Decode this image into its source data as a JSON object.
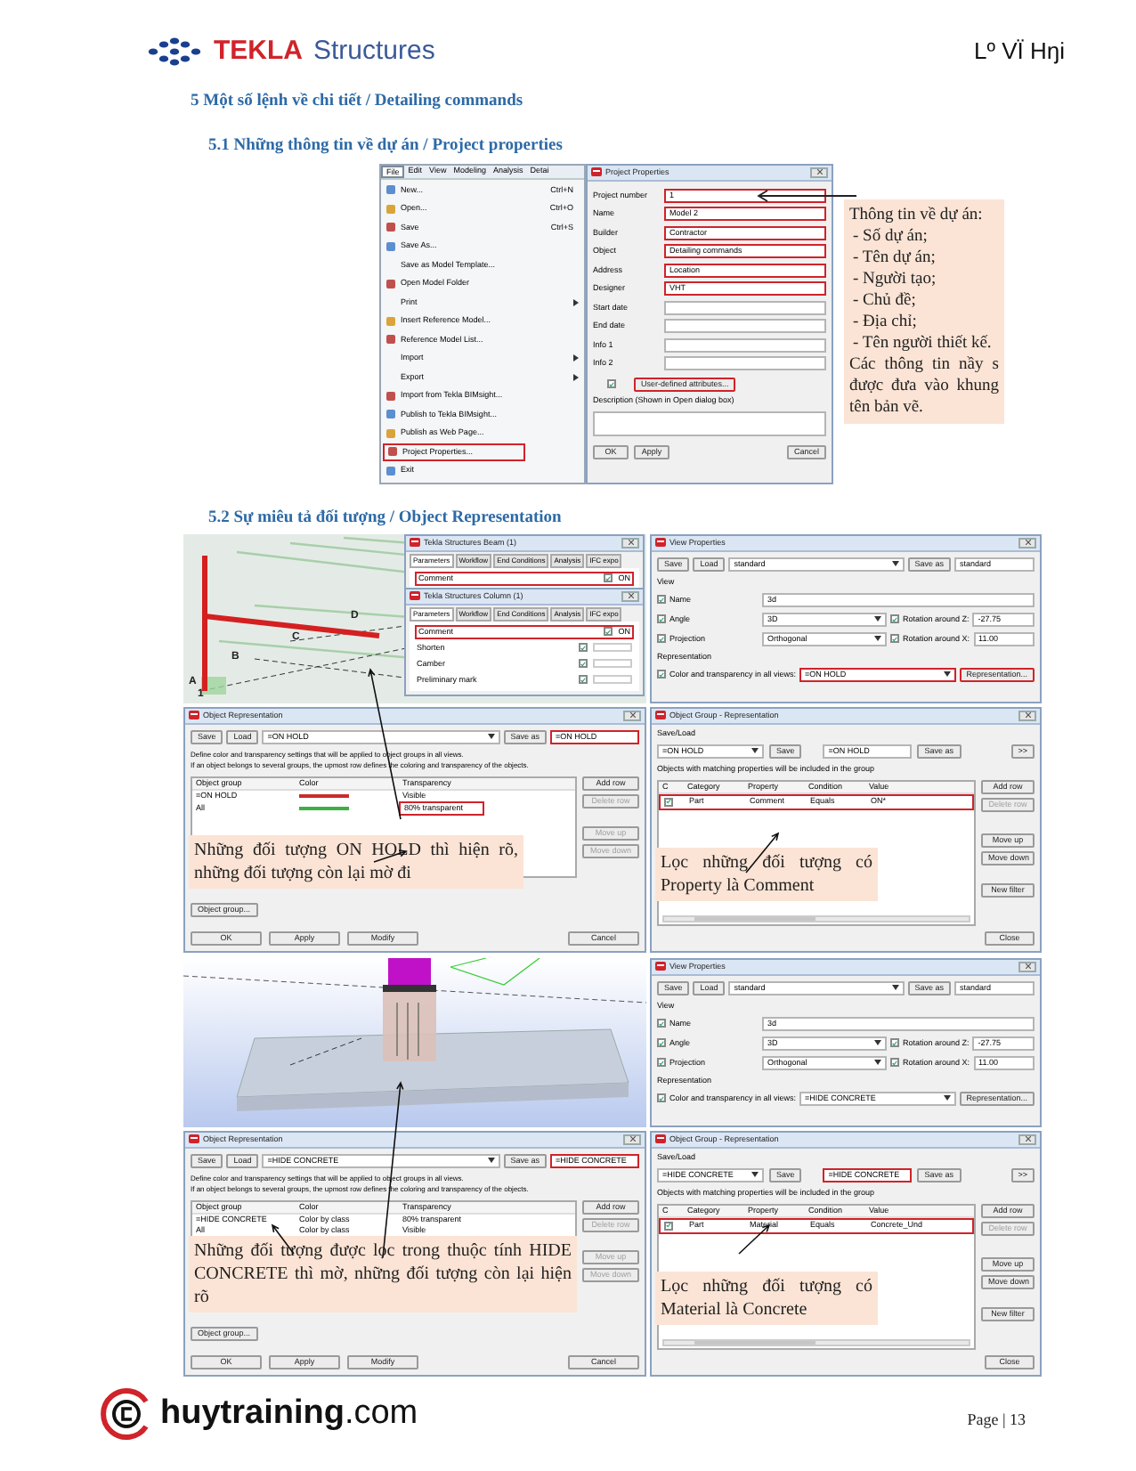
{
  "header": {
    "logo_word": "TEKLA",
    "logo_product": "Structures",
    "author": "Lº VÏ Hŋi"
  },
  "heading": "5 Một số lệnh về chi tiết / Detailing commands",
  "project_section": {
    "title": "5.1  Những thông tin về dự án / Project properties",
    "menubar": [
      {
        "label": "File",
        "selected": true
      },
      {
        "label": "Edit",
        "selected": false
      },
      {
        "label": "View",
        "selected": false
      },
      {
        "label": "Modeling",
        "selected": false
      },
      {
        "label": "Analysis",
        "selected": false
      },
      {
        "label": "Detai",
        "selected": false
      }
    ],
    "menu_items": [
      {
        "label": "New...",
        "shortcut": "Ctrl+N",
        "has_icon": true,
        "submenu": false,
        "highlighted": false
      },
      {
        "label": "Open...",
        "shortcut": "Ctrl+O",
        "has_icon": true,
        "submenu": false,
        "highlighted": false
      },
      {
        "label": "Save",
        "shortcut": "Ctrl+S",
        "has_icon": true,
        "submenu": false,
        "highlighted": false
      },
      {
        "label": "Save As...",
        "has_icon": true,
        "submenu": false,
        "highlighted": false
      },
      {
        "label": "Save as Model Template...",
        "has_icon": false,
        "submenu": false,
        "highlighted": false
      },
      {
        "label": "Open Model Folder",
        "has_icon": true,
        "submenu": false,
        "highlighted": false
      },
      {
        "label": "Print",
        "has_icon": false,
        "submenu": true,
        "highlighted": false
      },
      {
        "label": "Insert Reference Model...",
        "has_icon": true,
        "submenu": false,
        "highlighted": false
      },
      {
        "label": "Reference Model List...",
        "has_icon": true,
        "submenu": false,
        "highlighted": false
      },
      {
        "label": "Import",
        "has_icon": false,
        "submenu": true,
        "highlighted": false
      },
      {
        "label": "Export",
        "has_icon": false,
        "submenu": true,
        "highlighted": false
      },
      {
        "label": "Import from Tekla BIMsight...",
        "has_icon": true,
        "submenu": false,
        "highlighted": false
      },
      {
        "label": "Publish to Tekla BIMsight...",
        "has_icon": true,
        "submenu": false,
        "highlighted": false
      },
      {
        "label": "Publish as Web Page...",
        "has_icon": true,
        "submenu": false,
        "highlighted": false
      },
      {
        "label": "Project Properties...",
        "has_icon": true,
        "submenu": false,
        "highlighted": true
      },
      {
        "label": "Exit",
        "has_icon": true,
        "submenu": false,
        "highlighted": false
      }
    ],
    "dialog": {
      "title": "Project Properties",
      "fields": [
        {
          "label": "Project number",
          "value": "1",
          "highlighted": true
        },
        {
          "label": "Name",
          "value": "Model 2",
          "highlighted": true
        },
        {
          "label": "Builder",
          "value": "Contractor",
          "highlighted": true
        },
        {
          "label": "Object",
          "value": "Detailing commands",
          "highlighted": true
        },
        {
          "label": "Address",
          "value": "Location",
          "highlighted": true
        },
        {
          "label": "Designer",
          "value": "VHT",
          "highlighted": true
        },
        {
          "label": "Start date",
          "highlighted": false
        },
        {
          "label": "End date",
          "highlighted": false
        },
        {
          "label": "Info 1",
          "highlighted": false
        },
        {
          "label": "Info 2",
          "highlighted": false
        }
      ],
      "attributes_checked": true,
      "attributes_button": "User-defined attributes...",
      "attributes_highlighted": true,
      "description_label": "Description (Shown in Open dialog box)",
      "buttons": [
        "OK",
        "Apply",
        "Cancel"
      ]
    },
    "callout": {
      "lines": [
        "Thông tin về dự án:",
        "- Số dự án;",
        "- Tên dự án;",
        "- Người tạo;",
        "- Chủ đề;",
        "- Địa chỉ;",
        "- Tên người thiết kế."
      ],
      "note": "Các thông tin nầy s được đưa vào khung tên bản vẽ."
    }
  },
  "representation_section": {
    "title": "5.2  Sự miêu tả đối tượng / Object Representation",
    "figures": [
      {
        "kind": "steel_frame",
        "grid_labels": [
          "D",
          "C",
          "B",
          "A",
          "1"
        ],
        "part_dialogs": [
          {
            "title": "Tekla Structures  Beam (1)",
            "tabs": [
              {
                "label": "Parameters",
                "selected": true
              },
              {
                "label": "Workflow",
                "selected": false
              },
              {
                "label": "End Conditions",
                "selected": false
              },
              {
                "label": "Analysis",
                "selected": false
              },
              {
                "label": "IFC expo",
                "selected": false
              }
            ],
            "rows": [
              {
                "label": "Comment",
                "checked": true,
                "value": "ON",
                "highlighted": true
              }
            ]
          },
          {
            "title": "Tekla Structures  Column (1)",
            "tabs": [
              {
                "label": "Parameters",
                "selected": true
              },
              {
                "label": "Workflow",
                "selected": false
              },
              {
                "label": "End Conditions",
                "selected": false
              },
              {
                "label": "Analysis",
                "selected": false
              },
              {
                "label": "IFC expo",
                "selected": false
              }
            ],
            "rows": [
              {
                "label": "Comment",
                "checked": true,
                "value": "ON",
                "highlighted": true
              },
              {
                "label": "Shorten",
                "checked": true,
                "highlighted": false
              },
              {
                "label": "Camber",
                "checked": true,
                "highlighted": false
              },
              {
                "label": "Preliminary mark",
                "checked": true,
                "highlighted": false
              }
            ]
          }
        ],
        "view_properties": {
          "title": "View Properties",
          "save": "Save",
          "load": "Load",
          "load_value": "standard",
          "save_as": "Save as",
          "save_as_value": "standard",
          "group_label": "View",
          "fields": [
            {
              "label": "Name",
              "checked": true,
              "value": "3d"
            },
            {
              "label": "Angle",
              "checked": true,
              "value": "3D",
              "extra_checked": true,
              "extra_label": "Rotation around Z:",
              "extra_value": "-27.75"
            },
            {
              "label": "Projection",
              "checked": true,
              "value": "Orthogonal",
              "extra_checked": true,
              "extra_label": "Rotation around X:",
              "extra_value": "11.00"
            }
          ],
          "representation_label": "Representation",
          "color_checked": true,
          "color_label": "Color and transparency in all views:",
          "color_value": "=ON HOLD",
          "color_highlighted": true,
          "representation_button": "Representation...",
          "button_highlighted": true
        },
        "object_representation": {
          "title": "Object Representation",
          "save": "Save",
          "load": "Load",
          "load_value": "=ON HOLD",
          "save_as": "Save as",
          "save_as_value": "=ON HOLD",
          "save_as_highlighted": true,
          "description": [
            "Define color and transparency settings that will be applied to object groups in all views.",
            "If an object belongs to several groups, the upmost row defines the coloring and transparency of the objects."
          ],
          "columns": [
            "Object group",
            "Color",
            "Transparency"
          ],
          "rows": [
            {
              "group": "=ON HOLD",
              "color": "#cc2a2a",
              "transparency": "Visible",
              "highlighted": false
            },
            {
              "group": "All",
              "color": "#3cb043",
              "transparency": "80% transparent",
              "highlighted": true
            }
          ],
          "side_buttons": [
            {
              "label": "Add row",
              "disabled": false
            },
            {
              "label": "Delete row",
              "disabled": true
            },
            {
              "label": "Move up",
              "disabled": true
            },
            {
              "label": "Move down",
              "disabled": true
            }
          ],
          "object_group_button": "Object group...",
          "buttons": [
            "OK",
            "Apply",
            "Modify",
            "Cancel"
          ]
        },
        "object_group": {
          "title": "Object Group - Representation",
          "saveload_label": "Save/Load",
          "load_value": "=ON HOLD",
          "save": "Save",
          "name_value": "=ON HOLD",
          "name_highlighted": false,
          "save_as": "Save as",
          "more": ">>",
          "info": "Objects with matching properties will be included in the group",
          "columns": [
            "C",
            "Category",
            "Property",
            "Condition",
            "Value"
          ],
          "rows": [
            {
              "checked": true,
              "category": "Part",
              "property": "Comment",
              "condition": "Equals",
              "value": "ON*",
              "highlighted": true
            }
          ],
          "side_buttons": [
            {
              "label": "Add row",
              "disabled": false
            },
            {
              "label": "Delete row",
              "disabled": true
            },
            {
              "label": "Move up",
              "disabled": false
            },
            {
              "label": "Move down",
              "disabled": false
            },
            {
              "label": "New filter",
              "disabled": false
            }
          ],
          "close": "Close"
        },
        "callouts": [
          "Những đối tượng ON HOLD thì hiện rõ, những đối tượng còn lại mờ đi",
          "Lọc những đối tượng có Property là Comment"
        ]
      },
      {
        "kind": "footing",
        "view_properties": {
          "title": "View Properties",
          "save": "Save",
          "load": "Load",
          "load_value": "standard",
          "save_as": "Save as",
          "save_as_value": "standard",
          "group_label": "View",
          "fields": [
            {
              "label": "Name",
              "checked": true,
              "value": "3d"
            },
            {
              "label": "Angle",
              "checked": true,
              "value": "3D",
              "extra_checked": true,
              "extra_label": "Rotation around Z:",
              "extra_value": "-27.75"
            },
            {
              "label": "Projection",
              "checked": true,
              "value": "Orthogonal",
              "extra_checked": true,
              "extra_label": "Rotation around X:",
              "extra_value": "11.00"
            }
          ],
          "representation_label": "Representation",
          "color_checked": true,
          "color_label": "Color and transparency in all views:",
          "color_value": "=HIDE CONCRETE",
          "color_highlighted": false,
          "representation_button": "Representation...",
          "button_highlighted": false
        },
        "object_representation": {
          "title": "Object Representation",
          "save": "Save",
          "load": "Load",
          "load_value": "=HIDE CONCRETE",
          "save_as": "Save as",
          "save_as_value": "=HIDE CONCRETE",
          "save_as_highlighted": true,
          "description": [
            "Define color and transparency settings that will be applied to object groups in all views.",
            "If an object belongs to several groups, the upmost row defines the coloring and transparency of the objects."
          ],
          "columns": [
            "Object group",
            "Color",
            "Transparency"
          ],
          "rows": [
            {
              "group": "=HIDE CONCRETE",
              "color_label": "Color by class",
              "transparency": "80% transparent",
              "highlighted": false
            },
            {
              "group": "All",
              "color_label": "Color by class",
              "transparency": "Visible",
              "highlighted": false
            }
          ],
          "side_buttons": [
            {
              "label": "Add row",
              "disabled": false
            },
            {
              "label": "Delete row",
              "disabled": true
            },
            {
              "label": "Move up",
              "disabled": true
            },
            {
              "label": "Move down",
              "disabled": true
            }
          ],
          "object_group_button": "Object group...",
          "buttons": [
            "OK",
            "Apply",
            "Modify",
            "Cancel"
          ]
        },
        "object_group": {
          "title": "Object Group - Representation",
          "saveload_label": "Save/Load",
          "load_value": "=HIDE CONCRETE",
          "save": "Save",
          "name_value": "=HIDE CONCRETE",
          "name_highlighted": true,
          "save_as": "Save as",
          "more": ">>",
          "info": "Objects with matching properties will be included in the group",
          "columns": [
            "C",
            "Category",
            "Property",
            "Condition",
            "Value"
          ],
          "rows": [
            {
              "checked": true,
              "category": "Part",
              "property": "Material",
              "condition": "Equals",
              "value": "Concrete_Und",
              "highlighted": true
            }
          ],
          "side_buttons": [
            {
              "label": "Add row",
              "disabled": false
            },
            {
              "label": "Delete row",
              "disabled": true
            },
            {
              "label": "Move up",
              "disabled": false
            },
            {
              "label": "Move down",
              "disabled": false
            },
            {
              "label": "New filter",
              "disabled": false
            }
          ],
          "close": "Close"
        },
        "callouts": [
          "Những đối tượng được lọc trong thuộc tính HIDE CONCRETE thì mờ, những đối tượng còn lại hiện rõ",
          "Lọc những đối tượng có Material là Concrete"
        ]
      }
    ]
  },
  "footer": {
    "logo_name": "huytraining",
    "logo_domain": ".com",
    "page": "Page | 13"
  }
}
